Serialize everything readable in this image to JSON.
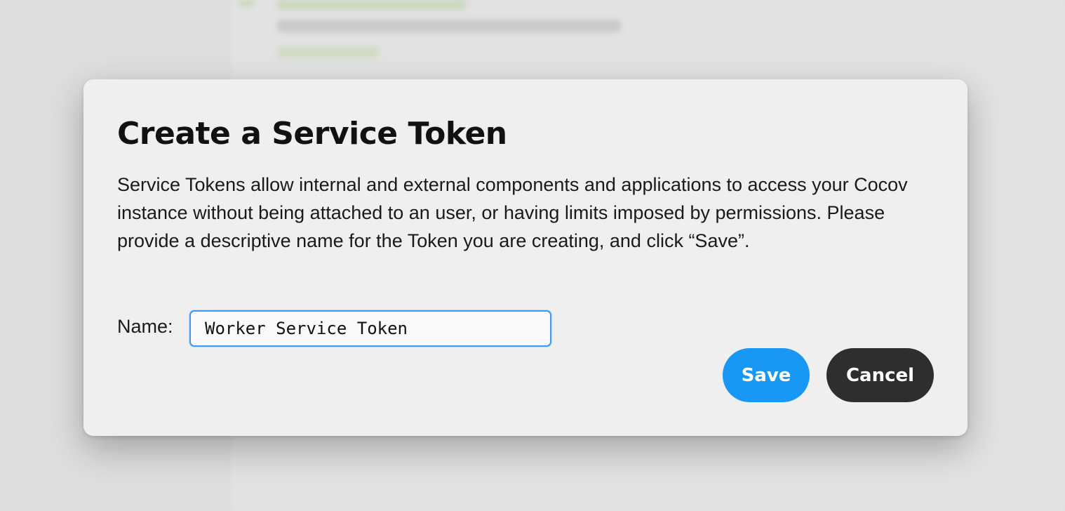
{
  "dialog": {
    "title": "Create a Service Token",
    "description": "Service Tokens allow internal and external components and applications to access your Cocov instance without being attached to an user, or having limits imposed by permissions. Please provide a descriptive name for the Token you are creating, and click “Save”.",
    "name_label": "Name:",
    "name_value": "Worker Service Token",
    "save_label": "Save",
    "cancel_label": "Cancel"
  },
  "colors": {
    "save_button": "#1997f5",
    "cancel_button": "#2e2e2e",
    "input_focus_border": "#3b9cf0"
  }
}
